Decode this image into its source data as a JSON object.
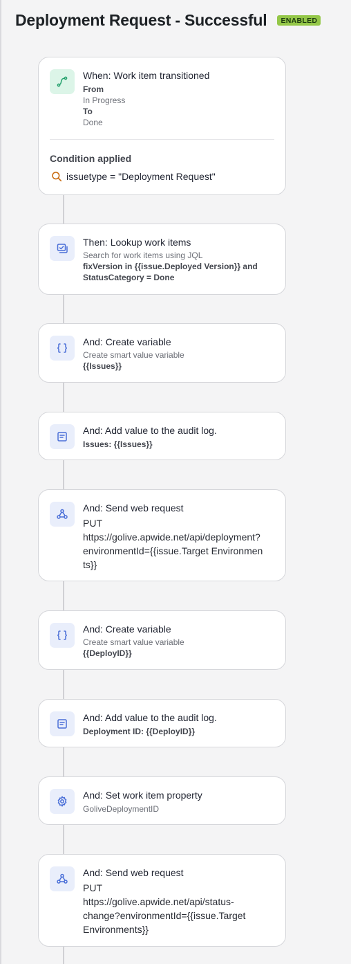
{
  "header": {
    "title": "Deployment Request - Successful",
    "status_badge": "ENABLED"
  },
  "trigger": {
    "title": "When: Work item transitioned",
    "from_label": "From",
    "from_value": "In Progress",
    "to_label": "To",
    "to_value": "Done",
    "condition_label": "Condition applied",
    "condition_text": "issuetype = \"Deployment Request\""
  },
  "steps": [
    {
      "title": "Then: Lookup work items",
      "sub": "Search for work items using JQL",
      "detail": "fixVersion in {{issue.Deployed Version}} and StatusCategory = Done",
      "icon": "lookup-icon"
    },
    {
      "title": "And: Create variable",
      "sub": "Create smart value variable",
      "detail": "{{Issues}}",
      "icon": "braces-icon"
    },
    {
      "title": "And: Add value to the audit log.",
      "detail": "Issues: {{Issues}}",
      "icon": "audit-log-icon"
    },
    {
      "title": "And: Send web request",
      "method": "PUT",
      "url": "https://golive.apwide.net/api/deployment?environmentId={{issue.Target Environments}}",
      "icon": "webhook-icon"
    },
    {
      "title": "And: Create variable",
      "sub": "Create smart value variable",
      "detail": "{{DeployID}}",
      "icon": "braces-icon"
    },
    {
      "title": "And: Add value to the audit log.",
      "detail": "Deployment ID: {{DeployID}}",
      "icon": "audit-log-icon"
    },
    {
      "title": "And: Set work item property",
      "sub": "GoliveDeploymentID",
      "icon": "gear-icon"
    },
    {
      "title": "And: Send web request",
      "method": "PUT",
      "url": "https://golive.apwide.net/api/status-change?environmentId={{issue.Target Environments}}",
      "icon": "webhook-icon"
    }
  ],
  "colors": {
    "badge": "#94c748",
    "icon_blue": "#4a6fd8",
    "icon_green": "#22a06b",
    "search_icon": "#c96b10"
  }
}
